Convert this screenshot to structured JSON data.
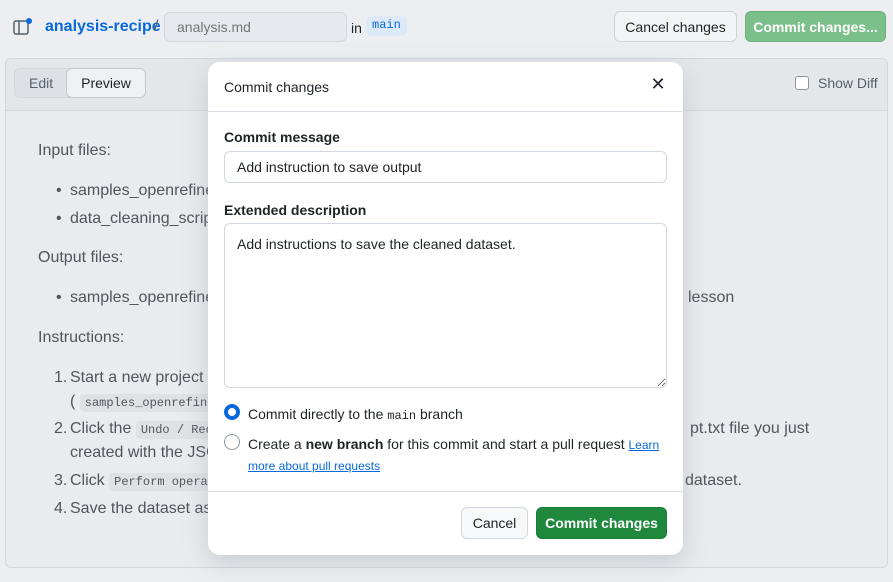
{
  "header": {
    "repo_name": "analysis-recipe",
    "separator": "/",
    "filename_placeholder": "analysis.md",
    "in_label": "in",
    "branch": "main",
    "cancel_label": "Cancel changes",
    "commit_label": "Commit changes..."
  },
  "editor": {
    "tabs": [
      {
        "label": "Edit",
        "active": false
      },
      {
        "label": "Preview",
        "active": true
      }
    ],
    "show_diff_label": "Show Diff"
  },
  "preview": {
    "input_heading": "Input files:",
    "input_items": [
      "samples_openrefine",
      "data_cleaning_script"
    ],
    "output_heading": "Output files:",
    "output_item_start": "samples_openrefine",
    "output_item_end": "lesson",
    "instructions_heading": "Instructions:",
    "steps": [
      {
        "num": "1.",
        "text": "Start a new project i",
        "line2_open": "(",
        "line2_code": "samples_openrefine"
      },
      {
        "num": "2.",
        "text": "Click the",
        "code": "Undo / Red",
        "end": "pt.txt file you just",
        "line2": "created with the JSO"
      },
      {
        "num": "3.",
        "text": "Click",
        "code": "Perform opera",
        "end": "dataset."
      },
      {
        "num": "4.",
        "text": "Save the dataset as"
      }
    ]
  },
  "modal": {
    "title": "Commit changes",
    "close_icon": "close-icon",
    "commit_message_label": "Commit message",
    "commit_message_value": "Add instruction to save output",
    "extended_label": "Extended description",
    "extended_value": "Add instructions to save the cleaned dataset.",
    "option_direct_prefix": "Commit directly to the",
    "option_direct_branch": "main",
    "option_direct_suffix": "branch",
    "option_new_prefix": "Create a",
    "option_new_bold": "new branch",
    "option_new_suffix": "for this commit and start a pull request",
    "learn_more": "Learn more about pull requests",
    "cancel_label": "Cancel",
    "commit_label": "Commit changes",
    "selected_option": "direct"
  },
  "colors": {
    "link": "#0969da",
    "primary_green": "#1f883d",
    "disabled_green": "#7bbf8a"
  }
}
